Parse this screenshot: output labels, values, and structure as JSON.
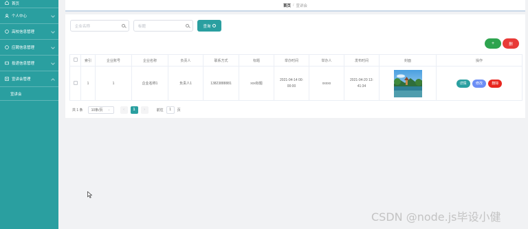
{
  "sidebar": {
    "items": [
      {
        "label": "首页",
        "icon": "home-icon",
        "has_children": false
      },
      {
        "label": "个人中心",
        "icon": "user-icon",
        "has_children": true
      },
      {
        "label": "高校信息管理",
        "icon": "building-icon",
        "has_children": true
      },
      {
        "label": "应聘信息管理",
        "icon": "document-icon",
        "has_children": true
      },
      {
        "label": "投递信息管理",
        "icon": "send-icon",
        "has_children": true
      },
      {
        "label": "宣讲会管理",
        "icon": "list-icon",
        "has_children": true
      }
    ],
    "subitem": "宣讲会"
  },
  "breadcrumb": {
    "home": "首页",
    "separator": "/",
    "current": "宣讲会"
  },
  "search": {
    "company_placeholder": "企业名称",
    "title_placeholder": "标题",
    "query_label": "查询",
    "query_icon": "search-icon"
  },
  "actions": {
    "add_label": "+",
    "delete_label": "删"
  },
  "table": {
    "headers": [
      "",
      "索引",
      "企业账号",
      "企业名称",
      "负责人",
      "联系方式",
      "标题",
      "举办时间",
      "举办人",
      "发布时间",
      "封面",
      "操作"
    ],
    "rows": [
      {
        "index": "1",
        "account": "1",
        "company": "企业名称1",
        "manager": "负责人1",
        "phone": "13823888881",
        "title": "xxx标题",
        "hold_time_line1": "2021-04-14 00:",
        "hold_time_line2": "00:00",
        "holder": "xxxxx",
        "publish_time_line1": "2021-04-20 13:",
        "publish_time_line2": "41:34",
        "cover": "landscape-thumbnail",
        "ops": {
          "detail": "详情",
          "edit": "修改",
          "delete": "删除"
        }
      }
    ]
  },
  "pagination": {
    "total": "共 1 条",
    "page_size": "10条/页",
    "prev": "‹",
    "current": "1",
    "next": "›",
    "goto_label": "前往",
    "goto_value": "1",
    "page_suffix": "页"
  },
  "watermark": "CSDN @node.js毕设小健",
  "colors": {
    "sidebar": "#2a9fa0",
    "accent": "#2a9fa0",
    "add": "#2ea44f",
    "delete": "#e8261e",
    "edit": "#6c8ef5"
  }
}
